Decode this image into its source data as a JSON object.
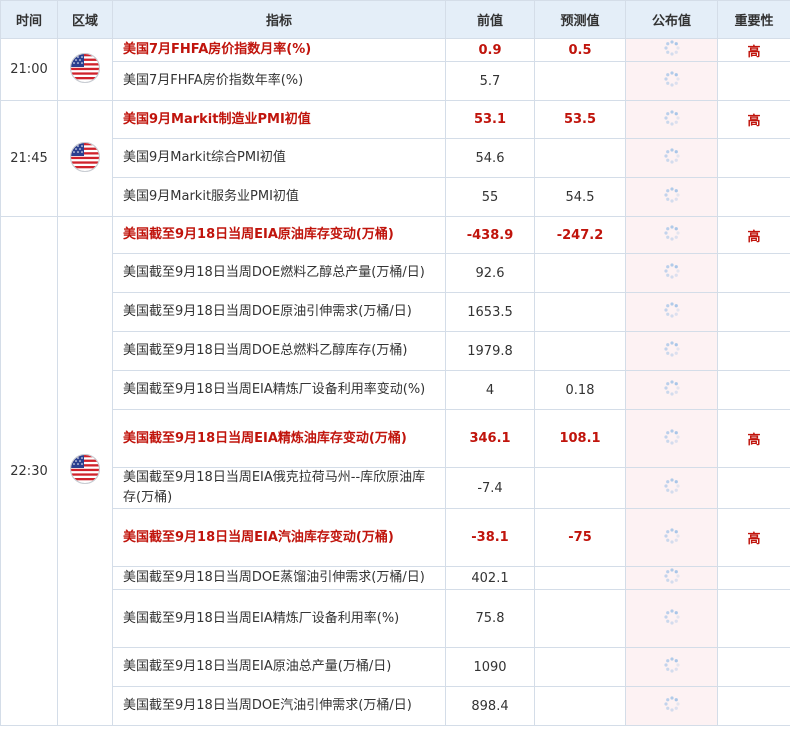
{
  "header": {
    "time": "时间",
    "region": "区域",
    "indicator": "指标",
    "previous": "前值",
    "forecast": "预测值",
    "actual": "公布值",
    "importance": "重要性"
  },
  "groups": [
    {
      "time": "21:00",
      "flag": "us-flag-icon",
      "rows": [
        {
          "indicator": "美国7月FHFA房价指数月率(%)",
          "previous": "0.9",
          "forecast": "0.5",
          "importance": "高",
          "important": true
        },
        {
          "indicator": "美国7月FHFA房价指数年率(%)",
          "previous": "5.7",
          "forecast": "",
          "importance": "",
          "important": false
        }
      ]
    },
    {
      "time": "21:45",
      "flag": "us-flag-icon",
      "rows": [
        {
          "indicator": "美国9月Markit制造业PMI初值",
          "previous": "53.1",
          "forecast": "53.5",
          "importance": "高",
          "important": true
        },
        {
          "indicator": "美国9月Markit综合PMI初值",
          "previous": "54.6",
          "forecast": "",
          "importance": "",
          "important": false
        },
        {
          "indicator": "美国9月Markit服务业PMI初值",
          "previous": "55",
          "forecast": "54.5",
          "importance": "",
          "important": false
        }
      ]
    },
    {
      "time": "22:30",
      "flag": "us-flag-icon",
      "rows": [
        {
          "indicator": "美国截至9月18日当周EIA原油库存变动(万桶)",
          "previous": "-438.9",
          "forecast": "-247.2",
          "importance": "高",
          "important": true
        },
        {
          "indicator": "美国截至9月18日当周DOE燃料乙醇总产量(万桶/日)",
          "previous": "92.6",
          "forecast": "",
          "importance": "",
          "important": false
        },
        {
          "indicator": "美国截至9月18日当周DOE原油引伸需求(万桶/日)",
          "previous": "1653.5",
          "forecast": "",
          "importance": "",
          "important": false
        },
        {
          "indicator": "美国截至9月18日当周DOE总燃料乙醇库存(万桶)",
          "previous": "1979.8",
          "forecast": "",
          "importance": "",
          "important": false
        },
        {
          "indicator": "美国截至9月18日当周EIA精炼厂设备利用率变动(%)",
          "previous": "4",
          "forecast": "0.18",
          "importance": "",
          "important": false
        },
        {
          "indicator": "美国截至9月18日当周EIA精炼油库存变动(万桶)",
          "previous": "346.1",
          "forecast": "108.1",
          "importance": "高",
          "important": true
        },
        {
          "indicator": "美国截至9月18日当周EIA俄克拉荷马州--库欣原油库存(万桶)",
          "previous": "-7.4",
          "forecast": "",
          "importance": "",
          "important": false
        },
        {
          "indicator": "美国截至9月18日当周EIA汽油库存变动(万桶)",
          "previous": "-38.1",
          "forecast": "-75",
          "importance": "高",
          "important": true
        },
        {
          "indicator": "美国截至9月18日当周DOE蒸馏油引伸需求(万桶/日)",
          "previous": "402.1",
          "forecast": "",
          "importance": "",
          "important": false
        },
        {
          "indicator": "美国截至9月18日当周EIA精炼厂设备利用率(%)",
          "previous": "75.8",
          "forecast": "",
          "importance": "",
          "important": false
        },
        {
          "indicator": "美国截至9月18日当周EIA原油总产量(万桶/日)",
          "previous": "1090",
          "forecast": "",
          "importance": "",
          "important": false
        },
        {
          "indicator": "美国截至9月18日当周DOE汽油引伸需求(万桶/日)",
          "previous": "898.4",
          "forecast": "",
          "importance": "",
          "important": false
        }
      ]
    }
  ],
  "colors": {
    "header_bg": "#e4eef8",
    "border": "#d4dde8",
    "important_text": "#c0140c",
    "actual_column_bg": "#fdf2f3",
    "spinner": "#a9c6e8"
  }
}
